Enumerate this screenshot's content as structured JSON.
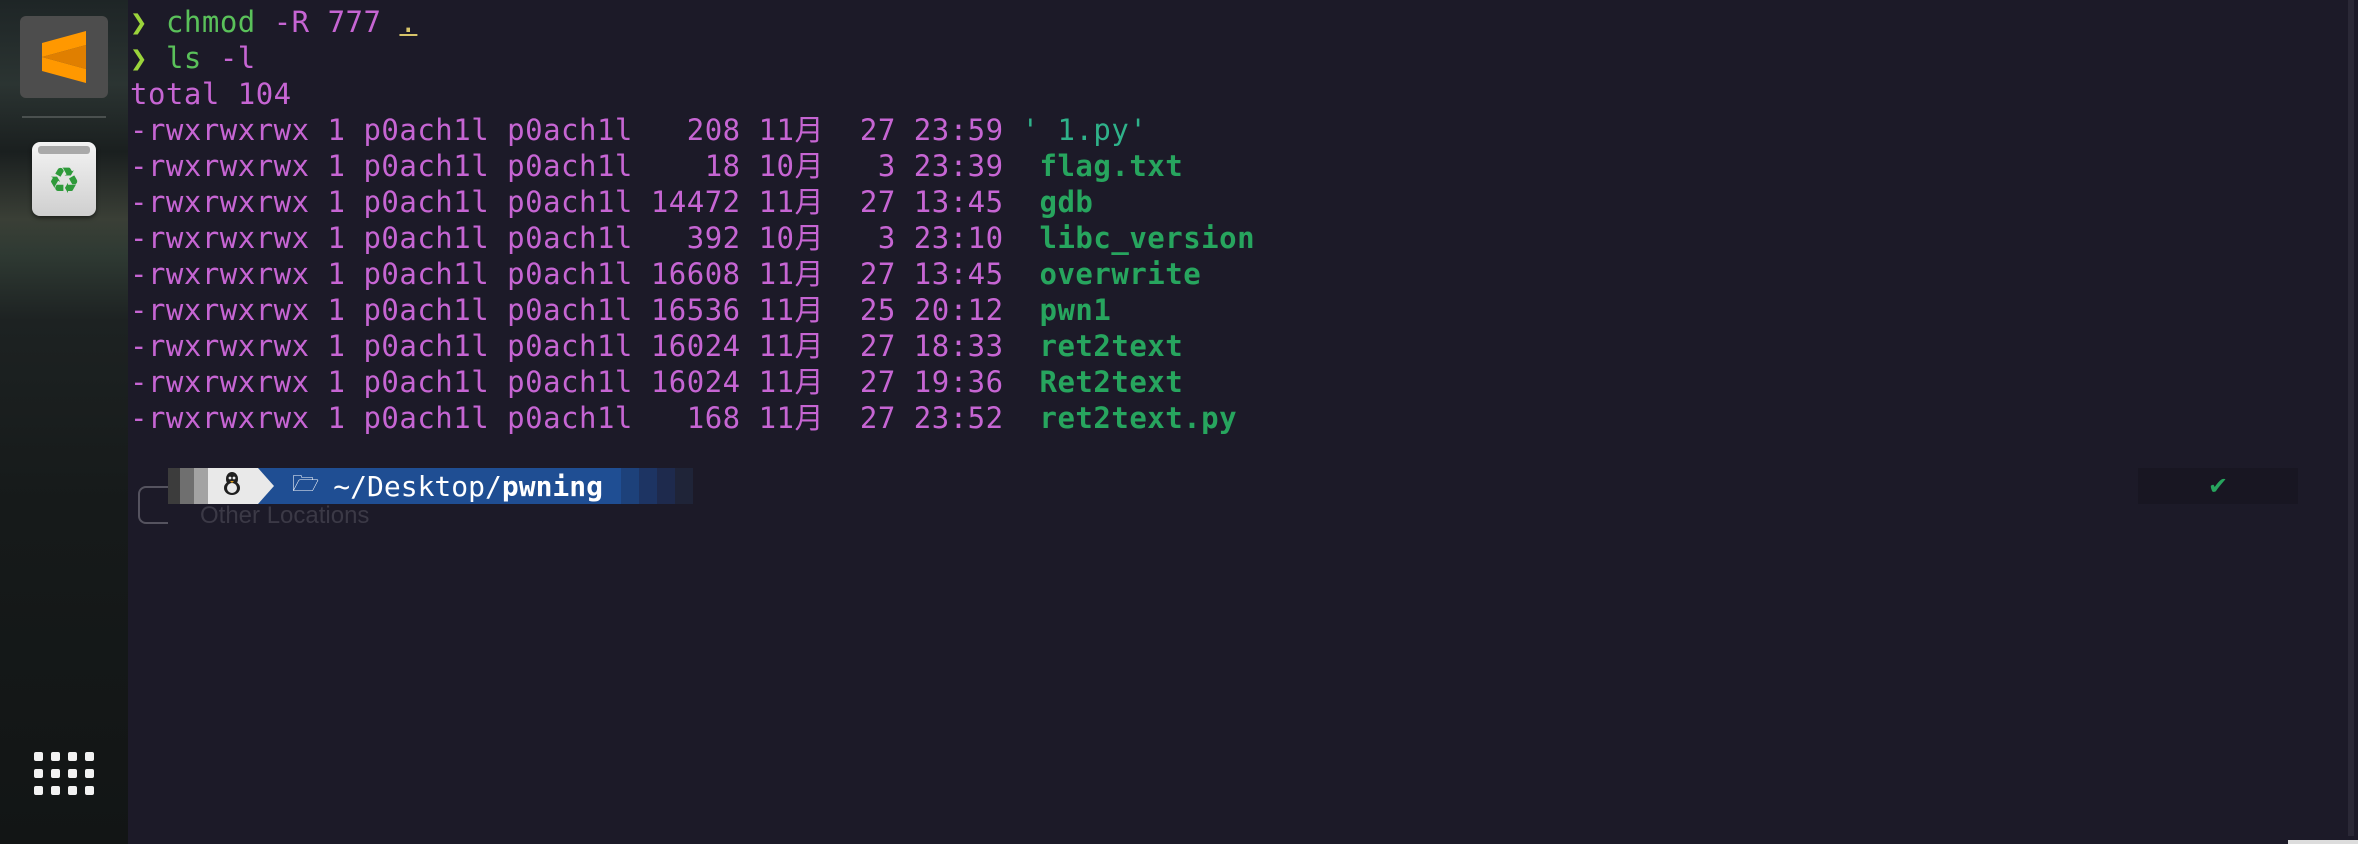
{
  "dock": {
    "apps": [
      {
        "name": "Sublime Text",
        "icon": "sublime-text-icon",
        "glyph": "S",
        "color": "#ff9800"
      },
      {
        "name": "Trash",
        "icon": "trash-icon",
        "glyph": "♻"
      }
    ],
    "show_apps_icon": "apps-grid-icon"
  },
  "terminal": {
    "prompt_symbol": "❯",
    "commands": [
      {
        "cmd": "chmod",
        "args": " -R 777 ",
        "target": "."
      },
      {
        "cmd": "ls",
        "args": " -l",
        "target": ""
      }
    ],
    "total_line": "total 104",
    "listing": [
      {
        "meta": "-rwxrwxrwx 1 p0ach1l p0ach1l   208 11月  27 23:59 ",
        "name": "' 1.py'",
        "quoted": true
      },
      {
        "meta": "-rwxrwxrwx 1 p0ach1l p0ach1l    18 10月   3 23:39  ",
        "name": "flag.txt",
        "quoted": false
      },
      {
        "meta": "-rwxrwxrwx 1 p0ach1l p0ach1l 14472 11月  27 13:45  ",
        "name": "gdb",
        "quoted": false
      },
      {
        "meta": "-rwxrwxrwx 1 p0ach1l p0ach1l   392 10月   3 23:10  ",
        "name": "libc_version",
        "quoted": false
      },
      {
        "meta": "-rwxrwxrwx 1 p0ach1l p0ach1l 16608 11月  27 13:45  ",
        "name": "overwrite",
        "quoted": false
      },
      {
        "meta": "-rwxrwxrwx 1 p0ach1l p0ach1l 16536 11月  25 20:12  ",
        "name": "pwn1",
        "quoted": false
      },
      {
        "meta": "-rwxrwxrwx 1 p0ach1l p0ach1l 16024 11月  27 18:33  ",
        "name": "ret2text",
        "quoted": false
      },
      {
        "meta": "-rwxrwxrwx 1 p0ach1l p0ach1l 16024 11月  27 19:36  ",
        "name": "Ret2text",
        "quoted": false
      },
      {
        "meta": "-rwxrwxrwx 1 p0ach1l p0ach1l   168 11月  27 23:52  ",
        "name": "ret2text.py",
        "quoted": false
      }
    ],
    "powerline": {
      "os_icon": "linux-tux-icon",
      "os_glyph": "🐧",
      "folder_glyph": "🗁",
      "path_prefix": "~/Desktop/",
      "path_current": "pwning",
      "status_glyph": "✔"
    },
    "ghost_text": {
      "other_locations": "Other Locations"
    }
  },
  "colors": {
    "background": "#1c1a28",
    "permissions": "#c665d3",
    "filename": "#27a55e",
    "path_segment": "#1f4e93"
  }
}
